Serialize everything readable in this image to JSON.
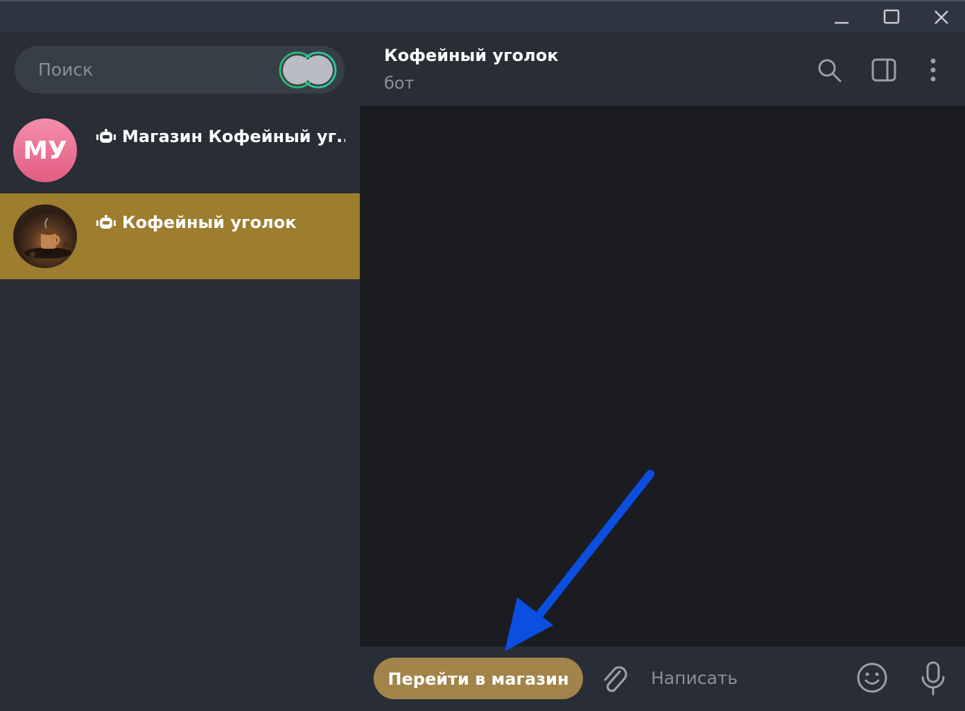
{
  "window_controls": [
    "minimize-icon",
    "maximize-icon",
    "close-icon"
  ],
  "sidebar": {
    "search_placeholder": "Поиск",
    "chats": [
      {
        "name": "Магазин Кофейный уг...",
        "avatar_initials": "МУ",
        "is_bot": true,
        "active": false
      },
      {
        "name": "Кофейный уголок",
        "avatar_initials": "",
        "is_bot": true,
        "active": true
      }
    ]
  },
  "chat": {
    "title": "Кофейный уголок",
    "status": "бот",
    "header_icons": [
      "search-icon",
      "sidebar-panel-icon",
      "more-vertical-icon"
    ]
  },
  "composer": {
    "shop_button_label": "Перейти в магазин",
    "input_placeholder": "Написать"
  },
  "colors": {
    "accent": "#9d7d2e",
    "shop_button": "#a2844a",
    "arrow": "#0b4ee0",
    "avatar_pink": "#e9678e"
  }
}
